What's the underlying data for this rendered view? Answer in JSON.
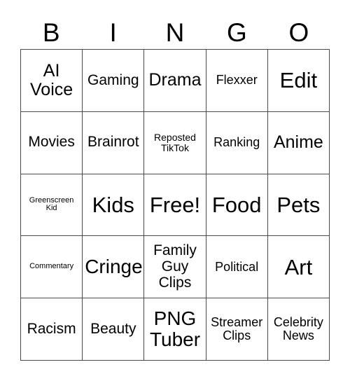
{
  "card": {
    "title": "BINGO",
    "header_letters": [
      "B",
      "I",
      "N",
      "G",
      "O"
    ],
    "columns": 5,
    "rows": 5,
    "colors": {
      "background": "#ffffff",
      "grid_line": "#4a4a4a",
      "text": "#000000"
    },
    "cells": [
      {
        "text": "AI\nVoice",
        "size": "lg",
        "marked": false
      },
      {
        "text": "Gaming",
        "size": "md",
        "marked": false
      },
      {
        "text": "Drama",
        "size": "lg",
        "marked": false
      },
      {
        "text": "Flexxer",
        "size": "sm",
        "marked": false
      },
      {
        "text": "Edit",
        "size": "xxl",
        "marked": false
      },
      {
        "text": "Movies",
        "size": "md",
        "marked": false
      },
      {
        "text": "Brainrot",
        "size": "md",
        "marked": false
      },
      {
        "text": "Reposted\nTikTok",
        "size": "xs",
        "marked": false
      },
      {
        "text": "Ranking",
        "size": "sm",
        "marked": false
      },
      {
        "text": "Anime",
        "size": "lg",
        "marked": false
      },
      {
        "text": "Greenscreen\nKid",
        "size": "xxs",
        "marked": false
      },
      {
        "text": "Kids",
        "size": "xxl",
        "marked": false
      },
      {
        "text": "Free!",
        "size": "xxl",
        "marked": false
      },
      {
        "text": "Food",
        "size": "xxl",
        "marked": false
      },
      {
        "text": "Pets",
        "size": "xxl",
        "marked": false
      },
      {
        "text": "Commentary",
        "size": "xxs",
        "marked": false
      },
      {
        "text": "Cringe",
        "size": "xl",
        "marked": false
      },
      {
        "text": "Family\nGuy\nClips",
        "size": "md",
        "marked": false
      },
      {
        "text": "Political",
        "size": "sm",
        "marked": false
      },
      {
        "text": "Art",
        "size": "xxl",
        "marked": false
      },
      {
        "text": "Racism",
        "size": "md",
        "marked": false
      },
      {
        "text": "Beauty",
        "size": "md",
        "marked": false
      },
      {
        "text": "PNG\nTuber",
        "size": "xl",
        "marked": false
      },
      {
        "text": "Streamer\nClips",
        "size": "sm",
        "marked": false
      },
      {
        "text": "Celebrity\nNews",
        "size": "sm",
        "marked": false
      }
    ]
  }
}
